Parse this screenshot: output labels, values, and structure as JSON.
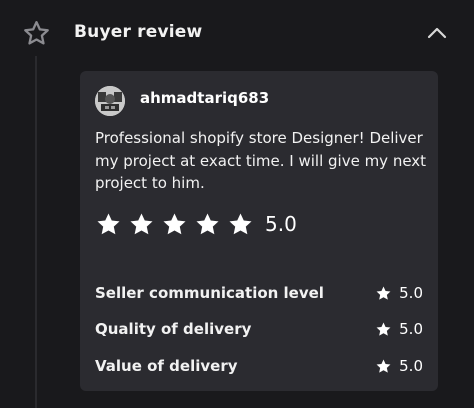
{
  "header": {
    "title": "Buyer review",
    "star_icon": "star-outline-icon",
    "collapse_icon": "chevron-up-icon"
  },
  "review": {
    "username": "ahmadtariq683",
    "avatar_icon": "avatar",
    "text": "Professional shopify store Designer! Deliver my project at exact time. I will give my next project to him.",
    "rating": 5,
    "rating_label": "5.0",
    "rating_out_of": 5,
    "metrics": [
      {
        "label": "Seller communication level",
        "value": "5.0"
      },
      {
        "label": "Quality of delivery",
        "value": "5.0"
      },
      {
        "label": "Value of delivery",
        "value": "5.0"
      }
    ]
  },
  "colors": {
    "background": "#19191c",
    "card": "#2b2b30",
    "text": "#ffffff",
    "icon_outline": "#8b8b90"
  }
}
